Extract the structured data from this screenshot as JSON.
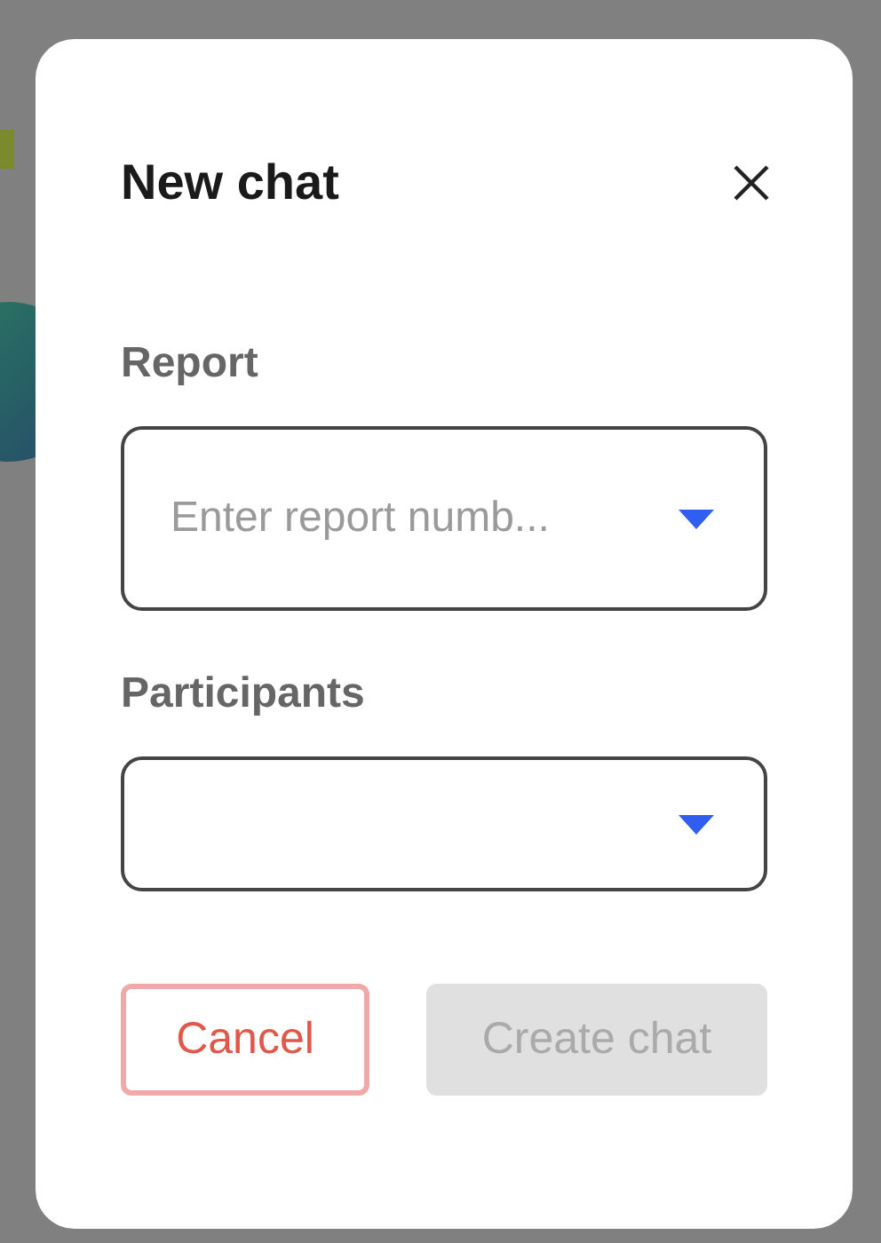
{
  "dialog": {
    "title": "New chat",
    "fields": [
      {
        "label": "Report",
        "placeholder": "Enter report numb..."
      },
      {
        "label": "Participants"
      }
    ],
    "buttons": [
      {
        "label": "Cancel",
        "kind": "secondary"
      },
      {
        "label": "Create chat",
        "kind": "primary",
        "disabled": true
      }
    ]
  }
}
